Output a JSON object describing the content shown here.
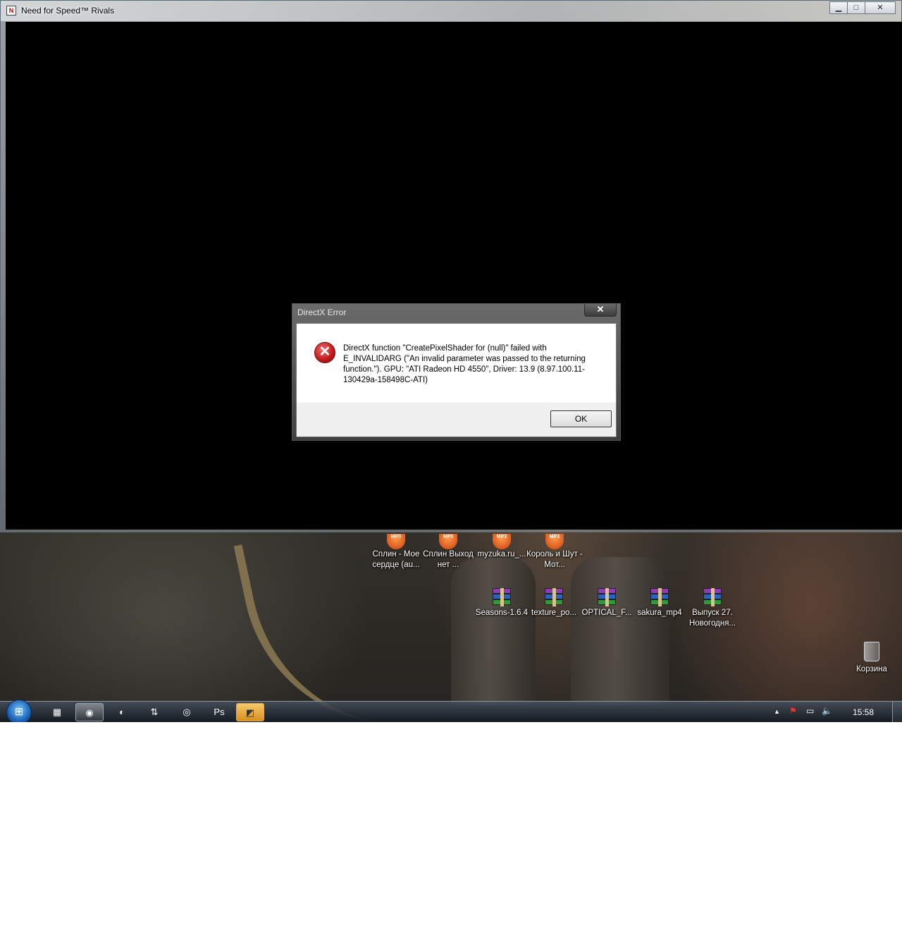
{
  "game_window": {
    "title": "Need for Speed™ Rivals",
    "icon": "nfs-app-icon",
    "minimize_glyph": "▁",
    "maximize_glyph": "□",
    "close_glyph": "✕"
  },
  "dialog": {
    "title": "DirectX Error",
    "close_glyph": "✕",
    "icon": "error-icon",
    "icon_glyph": "✕",
    "message": "DirectX function \"CreatePixelShader for (null)\" failed with E_INVALIDARG (\"An invalid parameter was passed to the returning function.\"). GPU: \"ATI Radeon HD 4550\", Driver: 13.9 (8.97.100.11-130429a-158498C-ATI)",
    "ok_label": "OK"
  },
  "desktop": {
    "mp3_badge": "MP3",
    "mp3_icons": [
      {
        "label": "Сплин - Мое сердце  (au..."
      },
      {
        "label": "Сплин Выход нет  ..."
      },
      {
        "label": "myzuka.ru_..."
      },
      {
        "label": "Король и Шут - Мот..."
      }
    ],
    "archives": [
      {
        "label": "Seasons-1.6.4"
      },
      {
        "label": "texture_po..."
      },
      {
        "label": "OPTICAL_F..."
      },
      {
        "label": "sakura_mp4"
      },
      {
        "label": "Выпуск 27. Новогодня..."
      }
    ],
    "recycle_bin": "Корзина"
  },
  "taskbar": {
    "start_glyph": "⊞",
    "pinned": [
      {
        "name": "app-grid-icon",
        "glyph": "▦"
      },
      {
        "name": "chrome-icon",
        "glyph": "◉"
      },
      {
        "name": "red-app-icon",
        "glyph": "◐"
      },
      {
        "name": "network-app-icon",
        "glyph": "⇅"
      },
      {
        "name": "green-app-icon",
        "glyph": "◎"
      },
      {
        "name": "photoshop-icon",
        "glyph": "Ps"
      },
      {
        "name": "nfs-taskbar-icon",
        "glyph": "◩"
      }
    ],
    "tray": {
      "show_hidden": "▲",
      "flag": "⚑",
      "network": "▭",
      "volume": "🔈",
      "time": "15:58"
    }
  },
  "colors": {
    "accent": "#1a5fb4",
    "error_red": "#c01818"
  }
}
